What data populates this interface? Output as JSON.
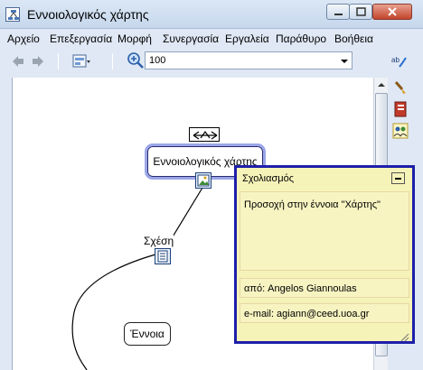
{
  "window": {
    "title": "Εννοιολογικός χάρτης"
  },
  "menu": {
    "items": [
      "Αρχείο",
      "Επεξεργασία",
      "Μορφή",
      "Συνεργασία",
      "Εργαλεία",
      "Παράθυρο",
      "Βοήθεια"
    ]
  },
  "toolbar": {
    "zoom_value": "100"
  },
  "map": {
    "main_concept": "Εννοιολογικός χάρτης",
    "relation": "Σχέση",
    "concept": "Έννοια"
  },
  "comment": {
    "title": "Σχολιασμός",
    "text": "Προσοχή στην έννοια \"Χάρτης\"",
    "author": "από: Angelos Giannoulas",
    "email": "e-mail: agiann@ceed.uoa.gr"
  },
  "colors": {
    "comment_border": "#1d1fa9",
    "comment_background": "#f6f3b9",
    "selected_concept_border": "#9aa6e8"
  }
}
